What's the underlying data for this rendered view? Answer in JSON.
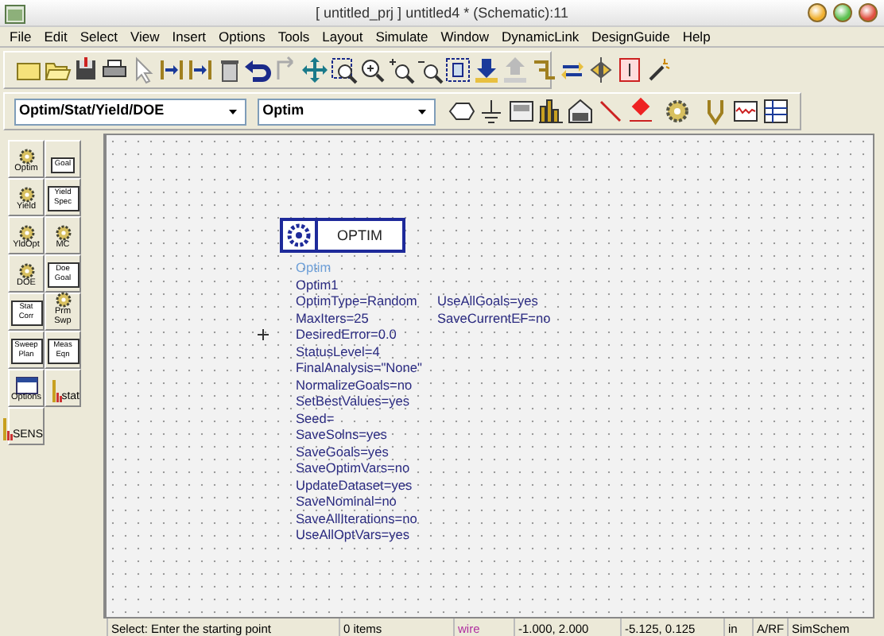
{
  "window": {
    "title": "[ untitled_prj ] untitled4 * (Schematic):11"
  },
  "menu": [
    {
      "label": "File"
    },
    {
      "label": "Edit"
    },
    {
      "label": "Select"
    },
    {
      "label": "View"
    },
    {
      "label": "Insert"
    },
    {
      "label": "Options"
    },
    {
      "label": "Tools"
    },
    {
      "label": "Layout"
    },
    {
      "label": "Simulate"
    },
    {
      "label": "Window"
    },
    {
      "label": "DynamicLink"
    },
    {
      "label": "DesignGuide"
    },
    {
      "label": "Help"
    }
  ],
  "palette_dropdown": {
    "value": "Optim/Stat/Yield/DOE"
  },
  "component_dropdown": {
    "value": "Optim"
  },
  "palette": [
    {
      "kind": "gear",
      "label": "Optim"
    },
    {
      "kind": "box",
      "label": "Goal"
    },
    {
      "kind": "gear",
      "label": "Yield"
    },
    {
      "kind": "box",
      "label": "Yield Spec"
    },
    {
      "kind": "gear",
      "label": "YldOpt"
    },
    {
      "kind": "gear",
      "label": "MC"
    },
    {
      "kind": "gear",
      "label": "DOE"
    },
    {
      "kind": "box",
      "label": "Doe Goal"
    },
    {
      "kind": "box",
      "label": "Stat Corr"
    },
    {
      "kind": "gear",
      "label": "Prm Swp"
    },
    {
      "kind": "box",
      "label": "Sweep Plan"
    },
    {
      "kind": "box",
      "label": "Meas Eqn"
    },
    {
      "kind": "window",
      "label": "Options"
    },
    {
      "kind": "bars",
      "label": "stat"
    },
    {
      "kind": "bars",
      "label": "SENS"
    }
  ],
  "component": {
    "title": "OPTIM",
    "type_label": "Optim",
    "instance": "Optim1",
    "params_left": [
      "OptimType=Random",
      "MaxIters=25",
      "DesiredError=0.0",
      "StatusLevel=4",
      "FinalAnalysis=\"None\"",
      "NormalizeGoals=no",
      "SetBestValues=yes",
      "Seed=",
      "SaveSolns=yes",
      "SaveGoals=yes",
      "SaveOptimVars=no",
      "UpdateDataset=yes",
      "SaveNominal=no",
      "SaveAllIterations=no",
      "UseAllOptVars=yes"
    ],
    "params_right": [
      "UseAllGoals=yes",
      "SaveCurrentEF=no"
    ]
  },
  "status_bar": {
    "message": "Select: Enter the starting point",
    "items": "0 items",
    "mode": "wire",
    "coords_1": "-1.000, 2.000",
    "coords_2": "-5.125, 0.125",
    "units": "in",
    "library": "A/RF",
    "simulator": "SimSchem"
  }
}
